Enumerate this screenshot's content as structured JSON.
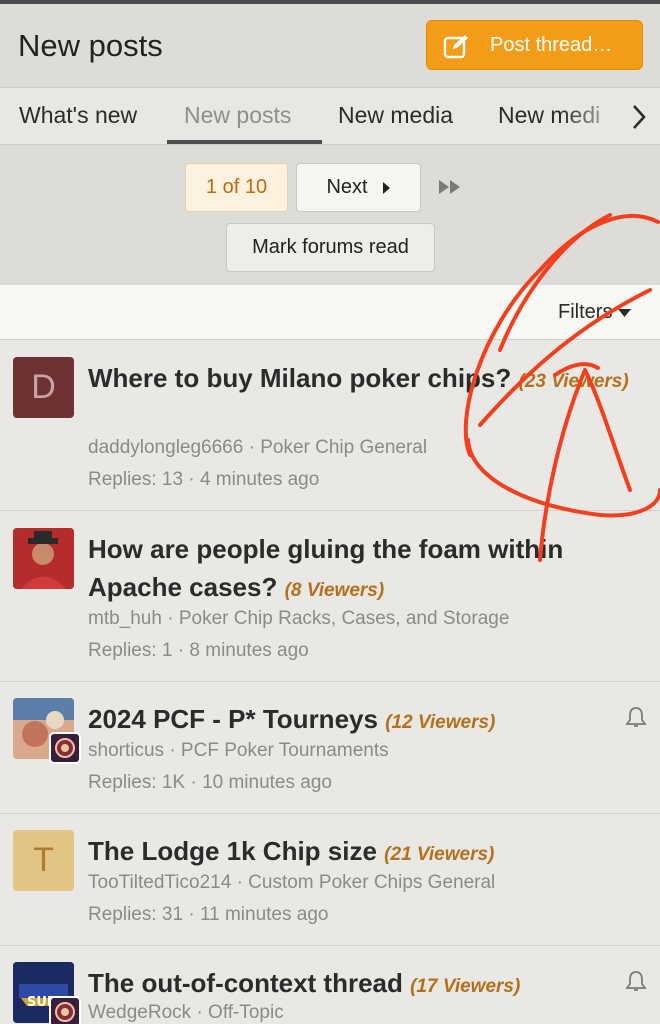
{
  "header": {
    "title": "New posts",
    "post_button_label": "Post thread…"
  },
  "tabs": [
    {
      "label": "What's new",
      "active": false
    },
    {
      "label": "New posts",
      "active": true
    },
    {
      "label": "New media",
      "active": false
    },
    {
      "label": "New medi",
      "active": false
    }
  ],
  "pager": {
    "current": "1 of 10",
    "next_label": "Next",
    "mark_read_label": "Mark forums read"
  },
  "filters": {
    "label": "Filters"
  },
  "threads": [
    {
      "avatar_letter": "D",
      "title": "Where to buy Milano poker chips?",
      "viewers": "(23 Viewers)",
      "author": "daddylongleg6666",
      "forum": "Poker Chip General",
      "replies": "Replies: 13",
      "time": "4 minutes ago"
    },
    {
      "avatar_letter": "",
      "title": "How are people gluing the foam within Apache cases?",
      "viewers": "(8 Viewers)",
      "author": "mtb_huh",
      "forum": "Poker Chip Racks, Cases, and Storage",
      "replies": "Replies: 1",
      "time": "8 minutes ago"
    },
    {
      "avatar_letter": "",
      "title": "2024 PCF - P* Tourneys",
      "viewers": "(12 Viewers)",
      "author": "shorticus",
      "forum": "PCF Poker Tournaments",
      "replies": "Replies: 1K",
      "time": "10 minutes ago"
    },
    {
      "avatar_letter": "T",
      "title": "The Lodge 1k Chip size",
      "viewers": "(21 Viewers)",
      "author": "TooTiltedTico214",
      "forum": "Custom Poker Chips General",
      "replies": "Replies: 31",
      "time": "11 minutes ago"
    },
    {
      "avatar_letter": "",
      "avatar_text": "SUPER",
      "title": "The out-of-context thread",
      "viewers": "(17 Viewers)",
      "author": "WedgeRock",
      "forum": "Off-Topic",
      "replies": "",
      "time": ""
    }
  ],
  "separator": "·",
  "colors": {
    "accent": "#f39c17",
    "viewers": "#b5701c",
    "annotation": "#f2401f"
  }
}
